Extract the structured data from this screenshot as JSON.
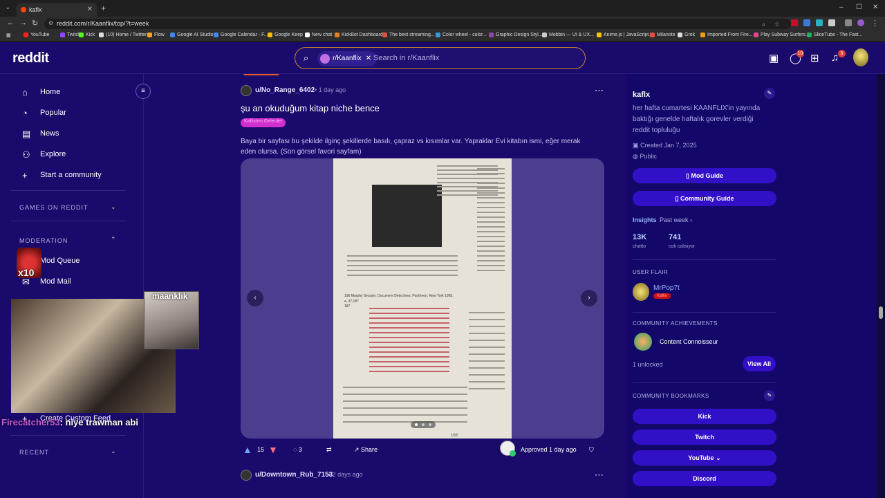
{
  "browser": {
    "tab_title": "kaflx",
    "url": "reddit.com/r/Kaanflix/top/?t=week",
    "bookmarks": [
      "YouTube",
      "Twitch",
      "Kick",
      "(10) Home / Twitter",
      "Flow",
      "Google AI Studio",
      "Google Calendar - F...",
      "Google Keep",
      "New chat",
      "KickBot Dashboard",
      "The best streaming...",
      "Color wheel - color...",
      "Graphic Design Styl...",
      "Mobbin — UI & UX...",
      "Anime.js | JavaScript...",
      "Milanote",
      "Grok",
      "Imported From Fire...",
      "Play Subway Surfers...",
      "SliceTube - The Fast..."
    ],
    "colors": {
      "tab_bg": "#2d2d2d",
      "omnibox_bg": "#1e1e1e"
    }
  },
  "header": {
    "logo": "reddit",
    "search_chip": "r/Kaanflix",
    "search_placeholder": "Search in r/Kaanflix",
    "chat_badge": "10",
    "notif_badge": "5"
  },
  "sidebar": {
    "items": [
      {
        "label": "Home",
        "icon": "home-icon"
      },
      {
        "label": "Popular",
        "icon": "popular-icon"
      },
      {
        "label": "News",
        "icon": "news-icon"
      },
      {
        "label": "Explore",
        "icon": "explore-icon"
      },
      {
        "label": "Start a community",
        "icon": "plus-icon"
      }
    ],
    "games_header": "GAMES ON REDDIT",
    "moderation_header": "MODERATION",
    "mod_items": [
      "Mod Queue",
      "Mod Mail"
    ],
    "custom_feed": "Create Custom Feed",
    "recent_header": "RECENT"
  },
  "post": {
    "author": "u/No_Range_6402",
    "time": "• 1 day ago",
    "title": "şu an okuduğum kitap niche bence",
    "flair": "Kaflixten Gelenler",
    "body": "Baya bir sayfası bu şekilde ilginç şekillerde basılı, çapraz vs kısımlar var. Yapraklar Evi kitabın ismi, eğer merak eden olursa. (Son görsel favori sayfam)",
    "votes": "15",
    "comments": "3",
    "share": "Share",
    "approved": "Approved",
    "approved_time": "1 day ago",
    "page_number": "168",
    "image_lines": [
      "196 Murphy Grosser, Document Detectives, Pantheon, New York 1995.",
      "a. 37,187",
      "187"
    ]
  },
  "next_post": {
    "author": "u/Downtown_Rub_7153",
    "time": "• 2 days ago"
  },
  "rail": {
    "name": "kaflx",
    "description": "her hafta cumartesi KAANFLIX'in yayında baktığı genelde haftalık gorevler verdiği reddit topluluğu",
    "created": "Created Jan 7, 2025",
    "visibility": "Public",
    "mod_guide": "Mod Guide",
    "community_guide": "Community Guide",
    "insights": "Insights",
    "period": "Past week",
    "stats": [
      {
        "num": "13K",
        "label": "chatto"
      },
      {
        "num": "741",
        "label": "cok calisiyor"
      }
    ],
    "user_flair_header": "USER FLAIR",
    "user_flair_name": "MrPop7t",
    "user_flair_tag": "Kaflix",
    "achievements_header": "COMMUNITY ACHIEVEMENTS",
    "achievement": "Content Connoisseur",
    "unlocked": "1 unlocked",
    "view_all": "View All",
    "bookmarks_header": "COMMUNITY BOOKMARKS",
    "bookmark_buttons": [
      "Kick",
      "Twitch",
      "YouTube",
      "Discord"
    ],
    "colors": {
      "button": "#3210c8",
      "bg": "#13086a"
    }
  },
  "stream_overlay": {
    "cam_name": "maanklik",
    "chat_user": "Firecatcher53",
    "chat_message": ": niye trawman abi",
    "multiplier": "x10"
  }
}
